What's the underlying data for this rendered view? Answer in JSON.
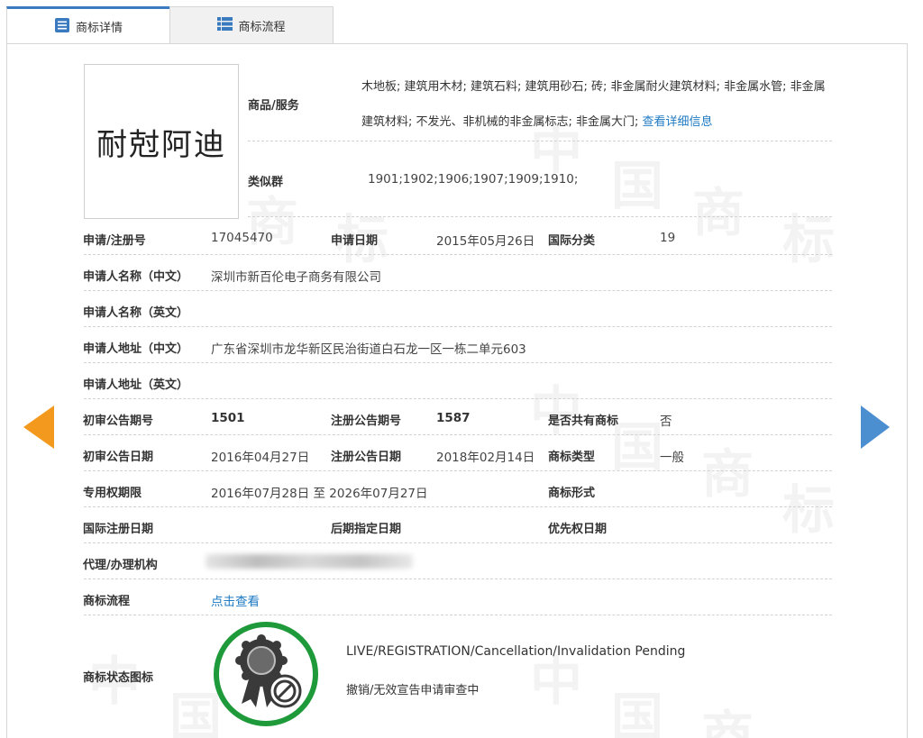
{
  "tabs": {
    "detail": "商标详情",
    "flow": "商标流程"
  },
  "logo": {
    "text": "耐尅阿迪"
  },
  "goods_label": "商品/服务",
  "goods_text": "木地板; 建筑用木材; 建筑石料; 建筑用砂石; 砖; 非金属耐火建筑材料; 非金属水管; 非金属建筑材料; 不发光、非机械的非金属标志; 非金属大门;",
  "goods_link": "查看详细信息",
  "similar_label": "类似群",
  "similar_value": "1901;1902;1906;1907;1909;1910;",
  "rows": {
    "reg_no_label": "申请/注册号",
    "reg_no": "17045470",
    "apply_date_label": "申请日期",
    "apply_date": "2015年05月26日",
    "intl_class_label": "国际分类",
    "intl_class": "19",
    "applicant_cn_label": "申请人名称（中文）",
    "applicant_cn": "深圳市新百伦电子商务有限公司",
    "applicant_en_label": "申请人名称（英文）",
    "applicant_en": "",
    "address_cn_label": "申请人地址（中文）",
    "address_cn": "广东省深圳市龙华新区民治街道白石龙一区一栋二单元603",
    "address_en_label": "申请人地址（英文）",
    "address_en": "",
    "prelim_no_label": "初审公告期号",
    "prelim_no": "1501",
    "reg_pub_no_label": "注册公告期号",
    "reg_pub_no": "1587",
    "shared_label": "是否共有商标",
    "shared": "否",
    "prelim_date_label": "初审公告日期",
    "prelim_date": "2016年04月27日",
    "reg_pub_date_label": "注册公告日期",
    "reg_pub_date": "2018年02月14日",
    "tm_type_label": "商标类型",
    "tm_type": "一般",
    "exclusive_label": "专用权期限",
    "exclusive": "2016年07月28日 至 2026年07月27日",
    "tm_form_label": "商标形式",
    "tm_form": "",
    "intl_reg_date_label": "国际注册日期",
    "intl_reg_date": "",
    "later_date_label": "后期指定日期",
    "later_date": "",
    "priority_date_label": "优先权日期",
    "priority_date": "",
    "agent_label": "代理/办理机构",
    "flow_label": "商标流程",
    "flow_link": "点击查看",
    "status_label": "商标状态图标"
  },
  "status": {
    "en": "LIVE/REGISTRATION/Cancellation/Invalidation Pending",
    "cn": "撤销/无效宣告申请审查中"
  },
  "watermark": {
    "chars": [
      "中",
      "国",
      "商",
      "标"
    ]
  },
  "colors": {
    "accent": "#3a7bbf",
    "link": "#1f7bc4",
    "arrow_left": "#f39a1e",
    "arrow_right": "#4c8fd0",
    "status_ring": "#1f9a3a"
  }
}
